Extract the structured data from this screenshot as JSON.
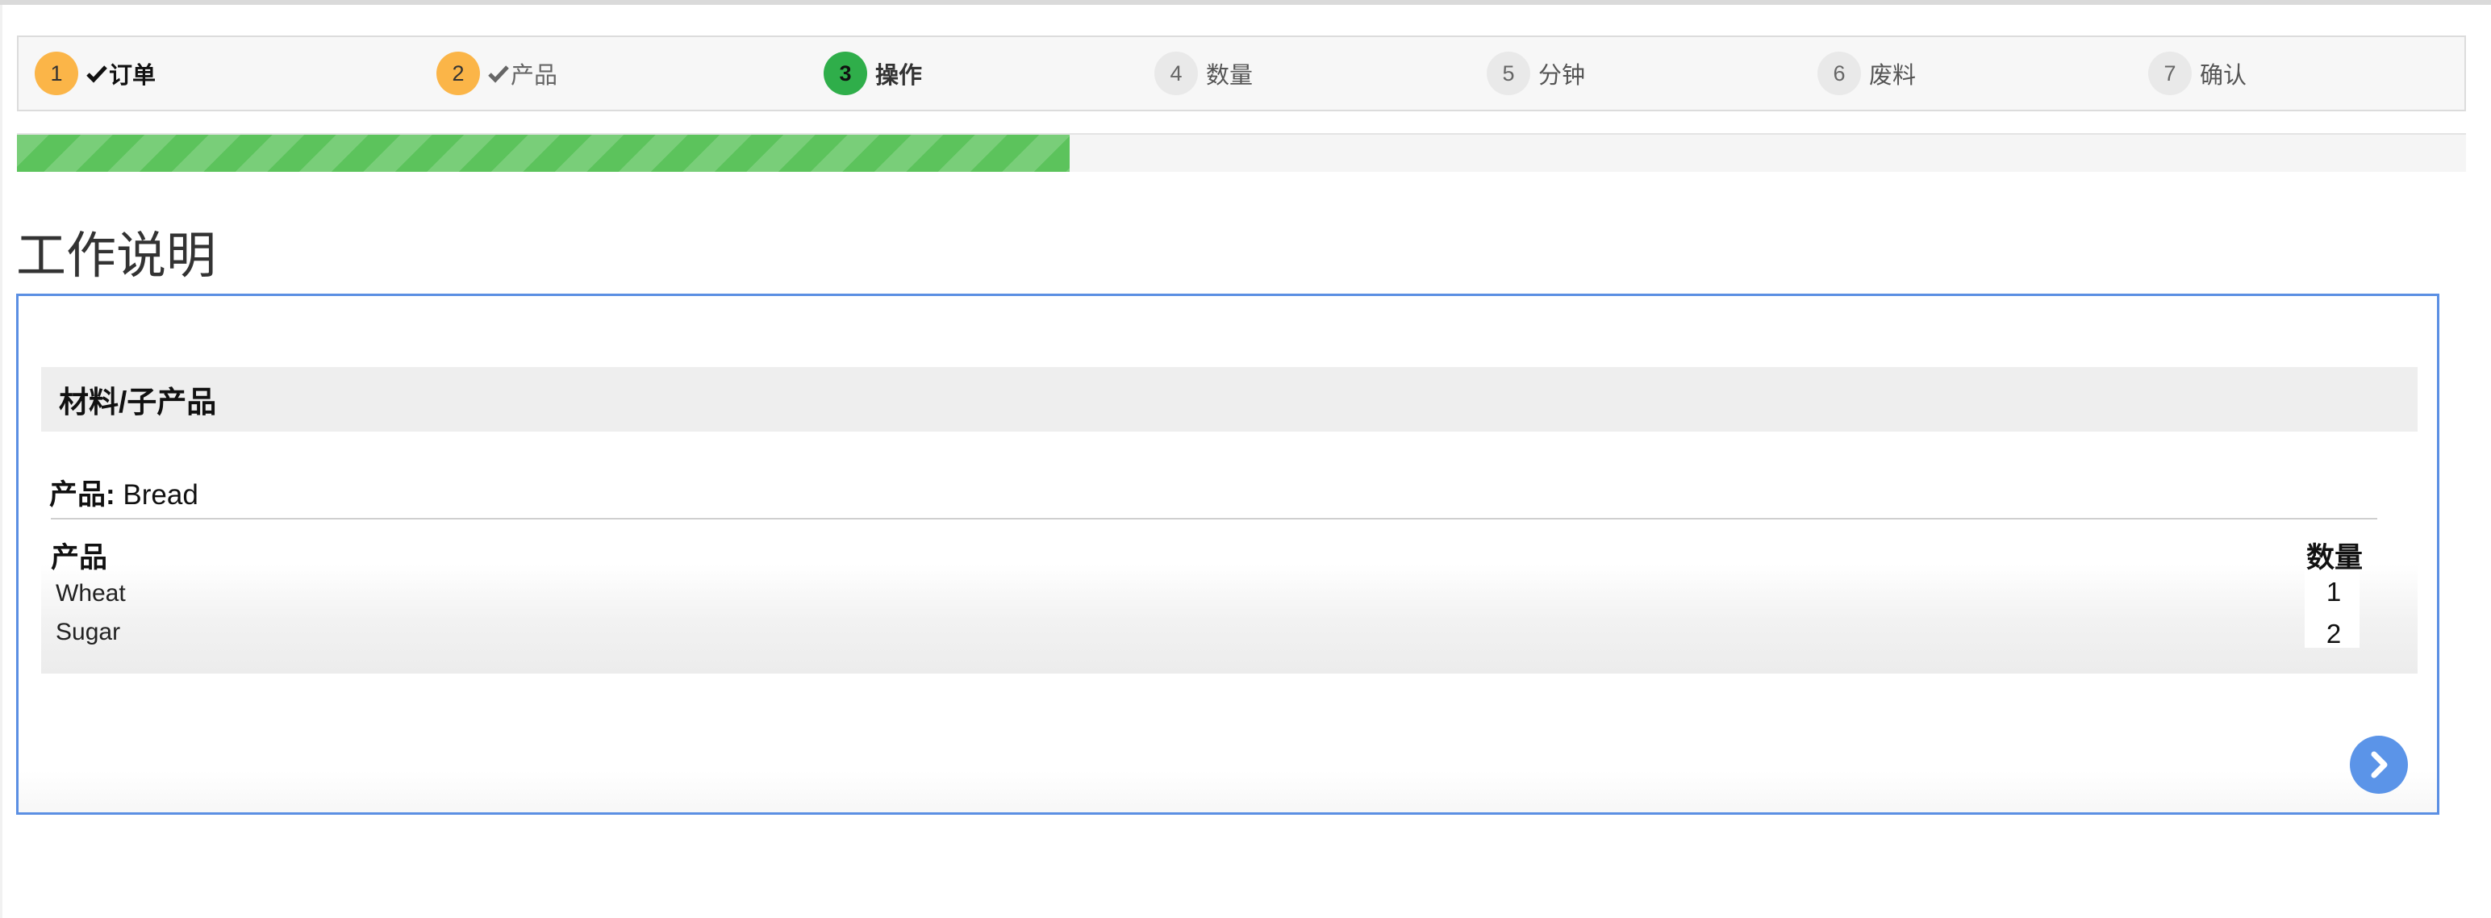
{
  "stepper": {
    "steps": [
      {
        "num": "1",
        "label": "订单",
        "state": "done"
      },
      {
        "num": "2",
        "label": "产品",
        "state": "done"
      },
      {
        "num": "3",
        "label": "操作",
        "state": "active"
      },
      {
        "num": "4",
        "label": "数量",
        "state": "pending"
      },
      {
        "num": "5",
        "label": "分钟",
        "state": "pending"
      },
      {
        "num": "6",
        "label": "废料",
        "state": "pending"
      },
      {
        "num": "7",
        "label": "确认",
        "state": "pending"
      }
    ]
  },
  "progress": {
    "fraction": 0.43
  },
  "page": {
    "title": "工作说明"
  },
  "materials": {
    "header": "材料/子产品",
    "product_label": "产品:",
    "product_value": "Bread",
    "columns": {
      "product": "产品",
      "quantity": "数量"
    },
    "rows": [
      {
        "name": "Wheat",
        "qty": "1"
      },
      {
        "name": "Sugar",
        "qty": "2"
      }
    ]
  },
  "colors": {
    "done": "#fbb548",
    "active": "#2fae4a",
    "progress": "#5cc35c",
    "accent": "#5b8fe3"
  },
  "icons": {
    "check": "check-icon",
    "next": "chevron-right-icon"
  }
}
